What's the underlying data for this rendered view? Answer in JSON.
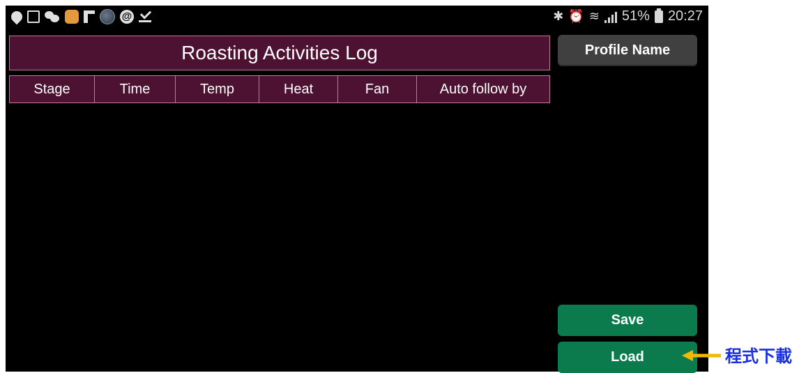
{
  "status_bar": {
    "battery": "51%",
    "time": "20:27",
    "left_icons": [
      "drop-icon",
      "image-icon",
      "wechat-icon",
      "app-icon",
      "f-icon",
      "ball-icon",
      "at-icon",
      "download-check-icon"
    ],
    "right_icons": [
      "bluetooth-icon",
      "alarm-icon",
      "wifi-icon",
      "signal-icon"
    ]
  },
  "title": "Roasting Activities Log",
  "table": {
    "columns": [
      "Stage",
      "Time",
      "Temp",
      "Heat",
      "Fan",
      "Auto follow by"
    ],
    "rows": []
  },
  "buttons": {
    "profile_name": "Profile Name",
    "save": "Save",
    "load": "Load"
  },
  "annotation": "程式下載",
  "colors": {
    "header_bg": "#4d1232",
    "green": "#0b7a4d",
    "profile_btn": "#404040",
    "annotation": "#1a2fe0",
    "arrow": "#f5b800"
  }
}
